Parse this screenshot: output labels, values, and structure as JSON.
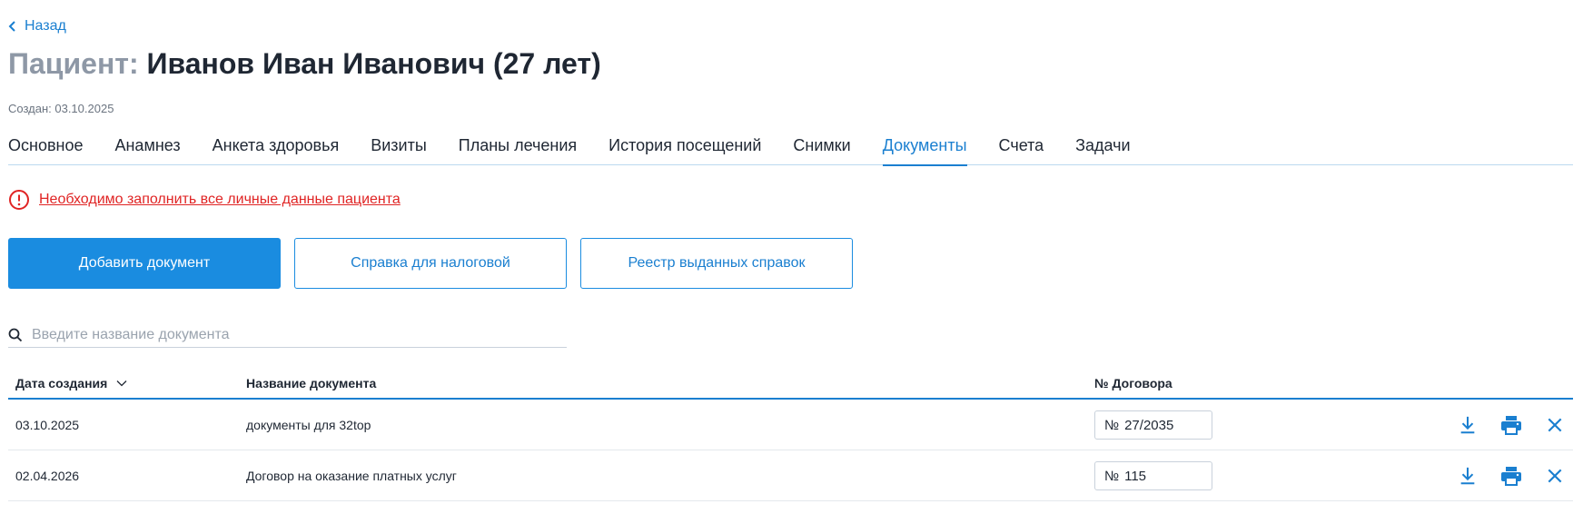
{
  "nav": {
    "back_label": "Назад"
  },
  "header": {
    "title_prefix": "Пациент:",
    "patient_name": "Иванов Иван Иванович (27 лет)",
    "created": "Создан: 03.10.2025"
  },
  "tabs": [
    {
      "label": "Основное",
      "active": false
    },
    {
      "label": "Анамнез",
      "active": false
    },
    {
      "label": "Анкета здоровья",
      "active": false
    },
    {
      "label": "Визиты",
      "active": false
    },
    {
      "label": "Планы лечения",
      "active": false
    },
    {
      "label": "История посещений",
      "active": false
    },
    {
      "label": "Снимки",
      "active": false
    },
    {
      "label": "Документы",
      "active": true
    },
    {
      "label": "Счета",
      "active": false
    },
    {
      "label": "Задачи",
      "active": false
    }
  ],
  "alert": {
    "text": "Необходимо заполнить все личные данные пациента",
    "icon": "alert-circle-icon",
    "color": "#e02424"
  },
  "buttons": {
    "add_document": "Добавить документ",
    "tax_certificate": "Справка для налоговой",
    "certificates_registry": "Реестр выданных справок"
  },
  "search": {
    "placeholder": "Введите название документа",
    "value": ""
  },
  "table": {
    "columns": {
      "date": "Дата создания",
      "name": "Название документа",
      "contract": "№ Договора"
    },
    "rows": [
      {
        "date": "03.10.2025",
        "name": "документы для 32top",
        "contract_prefix": "№",
        "contract": "27/2035"
      },
      {
        "date": "02.04.2026",
        "name": "Договор на оказание платных услуг",
        "contract_prefix": "№",
        "contract": "115"
      }
    ]
  },
  "colors": {
    "accent": "#1a8ce0",
    "link": "#1a7fd0",
    "error": "#e02424",
    "muted": "#8e98a6"
  }
}
